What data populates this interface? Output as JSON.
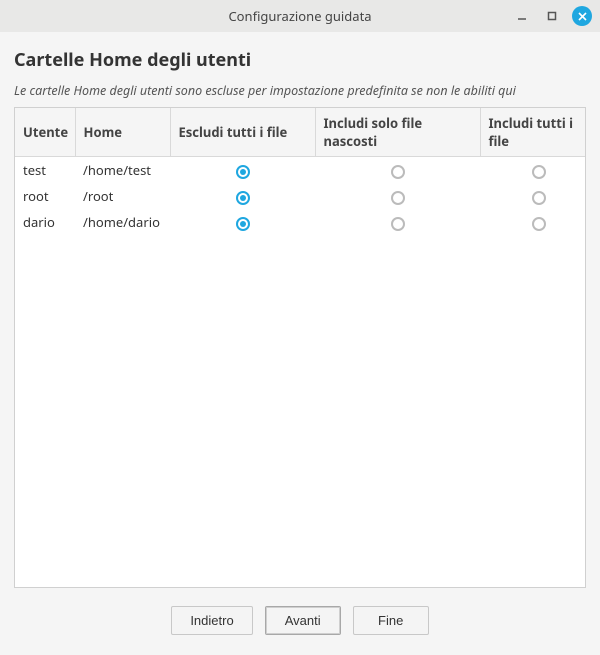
{
  "window": {
    "title": "Configurazione guidata"
  },
  "page": {
    "heading": "Cartelle Home degli utenti",
    "description": "Le cartelle Home degli utenti sono escluse per impostazione predefinita se non le abiliti qui"
  },
  "columns": {
    "user": "Utente",
    "home": "Home",
    "exclude_all": "Escludi tutti i file",
    "include_hidden": "Includi solo file nascosti",
    "include_all": "Includi tutti i file"
  },
  "rows": [
    {
      "user": "test",
      "home": "/home/test",
      "selection": "exclude_all"
    },
    {
      "user": "root",
      "home": "/root",
      "selection": "exclude_all"
    },
    {
      "user": "dario",
      "home": "/home/dario",
      "selection": "exclude_all"
    }
  ],
  "buttons": {
    "back": "Indietro",
    "next": "Avanti",
    "finish": "Fine"
  }
}
